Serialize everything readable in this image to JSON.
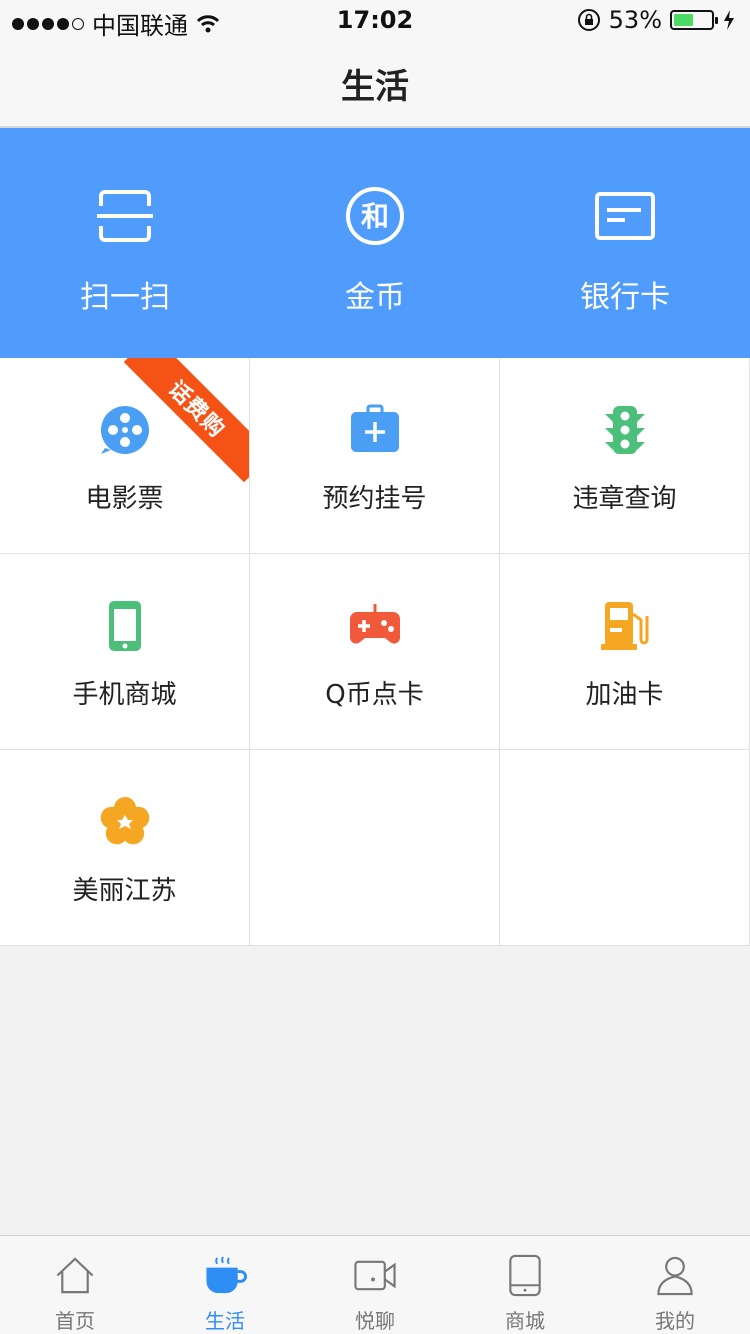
{
  "status_bar": {
    "carrier": "中国联通",
    "time": "17:02",
    "battery_percent": "53%",
    "battery_level": 0.53
  },
  "nav": {
    "title": "生活"
  },
  "hero": {
    "items": [
      {
        "label": "扫一扫",
        "icon": "scan-icon"
      },
      {
        "label": "金币",
        "icon": "coin-he-icon"
      },
      {
        "label": "银行卡",
        "icon": "bank-card-icon"
      }
    ],
    "background": "#4f9cfd"
  },
  "services": {
    "items": [
      {
        "label": "电影票",
        "icon": "film-reel-icon",
        "color": "#4a9ff5",
        "badge": "话费购"
      },
      {
        "label": "预约挂号",
        "icon": "medical-kit-icon",
        "color": "#4a9ff5"
      },
      {
        "label": "违章查询",
        "icon": "traffic-light-icon",
        "color": "#4cc07a"
      },
      {
        "label": "手机商城",
        "icon": "mobile-phone-icon",
        "color": "#4cc07a"
      },
      {
        "label": "Q币点卡",
        "icon": "gamepad-icon",
        "color": "#f05a3a"
      },
      {
        "label": "加油卡",
        "icon": "gas-pump-icon",
        "color": "#f5a623"
      },
      {
        "label": "美丽江苏",
        "icon": "flower-icon",
        "color": "#f5a623"
      }
    ],
    "badge_color": "#f55316"
  },
  "tab_bar": {
    "tabs": [
      {
        "label": "首页",
        "icon": "home-icon"
      },
      {
        "label": "生活",
        "icon": "coffee-cup-icon",
        "active": true
      },
      {
        "label": "悦聊",
        "icon": "video-camera-icon"
      },
      {
        "label": "商城",
        "icon": "tablet-icon"
      },
      {
        "label": "我的",
        "icon": "user-icon"
      }
    ],
    "active_color": "#2f8ef4"
  }
}
